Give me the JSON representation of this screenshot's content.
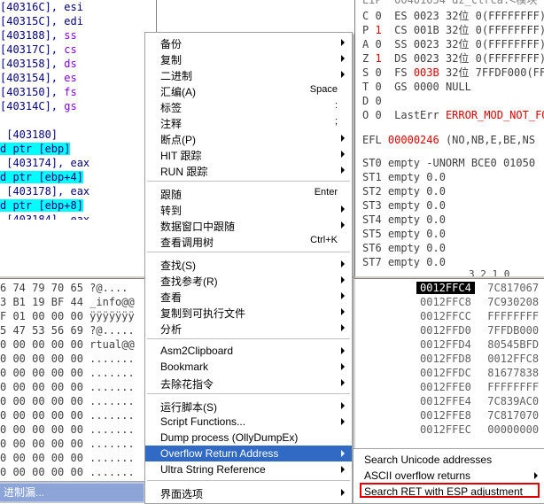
{
  "disasm": {
    "rows": [
      {
        "text": "[40316C], esi",
        "cls": "navy"
      },
      {
        "text": "[40315C], edi",
        "cls": "navy"
      },
      {
        "text": "[403188], ss",
        "cls": "mix",
        "a": "[403188], ",
        "b": "ss"
      },
      {
        "text": "[40317C], cs",
        "cls": "mix",
        "a": "[40317C], ",
        "b": "cs"
      },
      {
        "text": "[403158], ds",
        "cls": "mix",
        "a": "[403158], ",
        "b": "ds"
      },
      {
        "text": "[403154], es",
        "cls": "mix",
        "a": "[403154], ",
        "b": "es"
      },
      {
        "text": "[403150], fs",
        "cls": "mix",
        "a": "[403150], ",
        "b": "fs"
      },
      {
        "text": "[40314C], gs",
        "cls": "mix",
        "a": "[40314C], ",
        "b": "gs"
      },
      {
        "text": "",
        "cls": "navy"
      },
      {
        "text": " [403180]",
        "cls": "navy"
      },
      {
        "text": "d ptr [ebp]",
        "cls": "hl"
      },
      {
        "text": " [403174], eax",
        "cls": "navy"
      },
      {
        "text": "d ptr [ebp+4]",
        "cls": "hl"
      },
      {
        "text": " [403178], eax",
        "cls": "navy"
      },
      {
        "text": "d ptr [ebp+8]",
        "cls": "hl"
      },
      {
        "text": " [403184], eax",
        "cls": "navy"
      }
    ]
  },
  "registers": {
    "top_partial": "EIP  00401054 dz_clrca.<模块",
    "rows": [
      {
        "f": "C",
        "v": "0",
        "seg": "ES",
        "sel": "0023",
        "bits": "32位",
        "base": "0(FFFFFFFF)",
        "red": false
      },
      {
        "f": "P",
        "v": "1",
        "seg": "CS",
        "sel": "001B",
        "bits": "32位",
        "base": "0(FFFFFFFF)",
        "red": true
      },
      {
        "f": "A",
        "v": "0",
        "seg": "SS",
        "sel": "0023",
        "bits": "32位",
        "base": "0(FFFFFFFF)",
        "red": false
      },
      {
        "f": "Z",
        "v": "1",
        "seg": "DS",
        "sel": "0023",
        "bits": "32位",
        "base": "0(FFFFFFFF)",
        "red": true
      },
      {
        "f": "S",
        "v": "0",
        "seg": "FS",
        "sel": "003B",
        "bits": "32位",
        "base": "7FFDF000(FFF)",
        "red": false,
        "selred": true
      },
      {
        "f": "T",
        "v": "0",
        "seg": "GS",
        "sel": "0000",
        "bits": "NULL",
        "base": "",
        "red": false
      },
      {
        "f": "D",
        "v": "0",
        "seg": "",
        "sel": "",
        "bits": "",
        "base": "",
        "red": false
      },
      {
        "f": "O",
        "v": "0",
        "seg": "LastErr",
        "sel": "ERROR_MOD_NOT_FOUND",
        "bits": "",
        "base": "",
        "red": false,
        "lasterr": true
      }
    ],
    "efl": {
      "label": "EFL",
      "value": "00000246",
      "flags": "(NO,NB,E,BE,NS"
    },
    "st": [
      "ST0 empty -UNORM BCE0 01050",
      "ST1 empty 0.0",
      "ST2 empty 0.0",
      "ST3 empty 0.0",
      "ST4 empty 0.0",
      "ST5 empty 0.0",
      "ST6 empty 0.0",
      "ST7 empty 0.0"
    ],
    "fpu_bits": "3 2 1 0"
  },
  "dump": {
    "rows": [
      {
        "hex": "6 74 79 70 65",
        "asc": "?@...."
      },
      {
        "hex": "3 B1 19 BF 44",
        "asc": "_info@@"
      },
      {
        "hex": "F 01 00 00 00",
        "asc": "ÿÿÿÿÿÿÿ"
      },
      {
        "hex": "5 47 53 56 69",
        "asc": "?@....."
      },
      {
        "hex": "0 00 00 00 00",
        "asc": "rtual@@"
      },
      {
        "hex": "0 00 00 00 00",
        "asc": "......."
      },
      {
        "hex": "0 00 00 00 00",
        "asc": "......."
      },
      {
        "hex": "0 00 00 00 00",
        "asc": "......."
      },
      {
        "hex": "0 00 00 00 00",
        "asc": "......."
      },
      {
        "hex": "0 00 00 00 00",
        "asc": "......."
      },
      {
        "hex": "0 00 00 00 00",
        "asc": "......."
      },
      {
        "hex": "0 00 00 00 00",
        "asc": "......."
      },
      {
        "hex": "0 00 00 00 00",
        "asc": "......."
      },
      {
        "hex": "0 00 00 00 00",
        "asc": "......."
      }
    ]
  },
  "stack": {
    "rows": [
      {
        "addr": "0012FFC4",
        "val": "7C817067",
        "sel": true
      },
      {
        "addr": "0012FFC8",
        "val": "7C930208",
        "sel": false
      },
      {
        "addr": "0012FFCC",
        "val": "FFFFFFFF",
        "sel": false
      },
      {
        "addr": "0012FFD0",
        "val": "7FFDB000",
        "sel": false
      },
      {
        "addr": "0012FFD4",
        "val": "80545BFD",
        "sel": false
      },
      {
        "addr": "0012FFD8",
        "val": "0012FFC8",
        "sel": false
      },
      {
        "addr": "0012FFDC",
        "val": "81677838",
        "sel": false
      },
      {
        "addr": "0012FFE0",
        "val": "FFFFFFFF",
        "sel": false
      },
      {
        "addr": "0012FFE4",
        "val": "7C839AC0",
        "sel": false
      },
      {
        "addr": "0012FFE8",
        "val": "7C817070",
        "sel": false
      },
      {
        "addr": "0012FFEC",
        "val": "00000000",
        "sel": false
      }
    ]
  },
  "taskbar": {
    "label": "进制漏..."
  },
  "menu": {
    "items": [
      {
        "label": "备份",
        "shortcut": "",
        "arrow": true
      },
      {
        "label": "复制",
        "shortcut": "",
        "arrow": true
      },
      {
        "label": "二进制",
        "shortcut": "",
        "arrow": true
      },
      {
        "label": "汇编(A)",
        "shortcut": "Space",
        "arrow": false
      },
      {
        "label": "标签",
        "shortcut": ":",
        "arrow": false
      },
      {
        "label": "注释",
        "shortcut": ";",
        "arrow": false
      },
      {
        "label": "断点(P)",
        "shortcut": "",
        "arrow": true
      },
      {
        "label": "HIT 跟踪",
        "shortcut": "",
        "arrow": true
      },
      {
        "label": "RUN 跟踪",
        "shortcut": "",
        "arrow": true
      },
      {
        "sep": true
      },
      {
        "label": "跟随",
        "shortcut": "Enter",
        "arrow": false
      },
      {
        "label": "转到",
        "shortcut": "",
        "arrow": true
      },
      {
        "label": "数据窗口中跟随",
        "shortcut": "",
        "arrow": true
      },
      {
        "label": "查看调用树",
        "shortcut": "Ctrl+K",
        "arrow": false
      },
      {
        "sep": true
      },
      {
        "label": "查找(S)",
        "shortcut": "",
        "arrow": true
      },
      {
        "label": "查找参考(R)",
        "shortcut": "",
        "arrow": true
      },
      {
        "label": "查看",
        "shortcut": "",
        "arrow": true
      },
      {
        "label": "复制到可执行文件",
        "shortcut": "",
        "arrow": true
      },
      {
        "label": "分析",
        "shortcut": "",
        "arrow": true
      },
      {
        "sep": true
      },
      {
        "label": "Asm2Clipboard",
        "shortcut": "",
        "arrow": true
      },
      {
        "label": "Bookmark",
        "shortcut": "",
        "arrow": true
      },
      {
        "label": "去除花指令",
        "shortcut": "",
        "arrow": true
      },
      {
        "sep": true
      },
      {
        "label": "运行脚本(S)",
        "shortcut": "",
        "arrow": true
      },
      {
        "label": "Script Functions...",
        "shortcut": "",
        "arrow": true
      },
      {
        "label": "Dump process (OllyDumpEx)",
        "shortcut": "",
        "arrow": false
      },
      {
        "label": "Overflow Return Address",
        "shortcut": "",
        "arrow": true,
        "selected": true
      },
      {
        "label": "Ultra String Reference",
        "shortcut": "",
        "arrow": true
      },
      {
        "sep": true
      },
      {
        "label": "界面选项",
        "shortcut": "",
        "arrow": true
      }
    ]
  },
  "submenu": {
    "items": [
      {
        "label": "Search Unicode addresses",
        "arrow": false
      },
      {
        "label": "ASCII overflow returns",
        "arrow": true
      },
      {
        "label": "Search RET with ESP adjustment",
        "arrow": false,
        "highlighted": true
      }
    ]
  }
}
